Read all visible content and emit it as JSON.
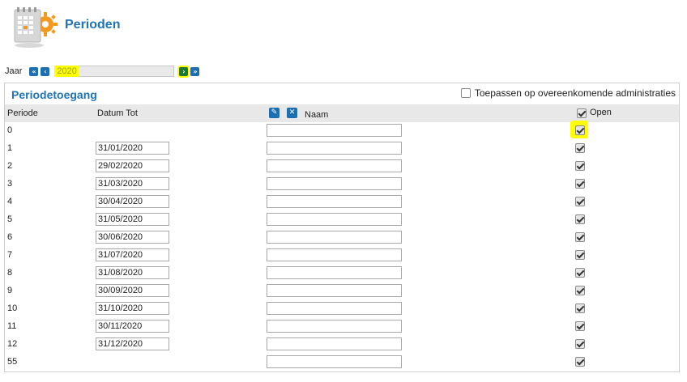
{
  "header": {
    "title": "Perioden",
    "icon": "calendar-gear-icon"
  },
  "year_bar": {
    "label": "Jaar",
    "year": "2020"
  },
  "panel": {
    "title": "Periodetoegang",
    "apply_label": "Toepassen op overeenkomende administraties",
    "apply_checked": false
  },
  "columns": {
    "periode": "Periode",
    "datum_tot": "Datum Tot",
    "naam": "Naam",
    "open": "Open"
  },
  "rows": [
    {
      "periode": "0",
      "datum": null,
      "naam": "",
      "open": true,
      "highlight": true
    },
    {
      "periode": "1",
      "datum": "31/01/2020",
      "naam": "",
      "open": true
    },
    {
      "periode": "2",
      "datum": "29/02/2020",
      "naam": "",
      "open": true
    },
    {
      "periode": "3",
      "datum": "31/03/2020",
      "naam": "",
      "open": true
    },
    {
      "periode": "4",
      "datum": "30/04/2020",
      "naam": "",
      "open": true
    },
    {
      "periode": "5",
      "datum": "31/05/2020",
      "naam": "",
      "open": true
    },
    {
      "periode": "6",
      "datum": "30/06/2020",
      "naam": "",
      "open": true
    },
    {
      "periode": "7",
      "datum": "31/07/2020",
      "naam": "",
      "open": true
    },
    {
      "periode": "8",
      "datum": "31/08/2020",
      "naam": "",
      "open": true
    },
    {
      "periode": "9",
      "datum": "30/09/2020",
      "naam": "",
      "open": true
    },
    {
      "periode": "10",
      "datum": "31/10/2020",
      "naam": "",
      "open": true
    },
    {
      "periode": "11",
      "datum": "30/11/2020",
      "naam": "",
      "open": true
    },
    {
      "periode": "12",
      "datum": "31/12/2020",
      "naam": "",
      "open": true
    },
    {
      "periode": "55",
      "datum": null,
      "naam": "",
      "open": true
    }
  ],
  "colors": {
    "accent": "#1e74b8",
    "highlight": "#ffff00",
    "header_bg": "#e8e8e8"
  }
}
